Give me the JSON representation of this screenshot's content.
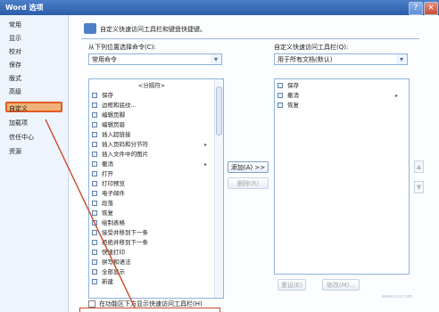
{
  "window": {
    "title": "Word 选项",
    "help_label": "?",
    "close_label": "×"
  },
  "nav": {
    "items": [
      {
        "label": "常用",
        "selected": false
      },
      {
        "label": "显示",
        "selected": false
      },
      {
        "label": "校对",
        "selected": false
      },
      {
        "label": "保存",
        "selected": false
      },
      {
        "label": "版式",
        "selected": false
      },
      {
        "label": "高级",
        "selected": false
      },
      {
        "label": "自定义",
        "selected": true
      },
      {
        "label": "加载项",
        "selected": false
      },
      {
        "label": "信任中心",
        "selected": false
      },
      {
        "label": "资源",
        "selected": false
      }
    ]
  },
  "main": {
    "heading": "自定义快速访问工具栏和键盘快捷键。",
    "left_label": "从下列位置选择命令(C):",
    "left_select_value": "常用命令",
    "right_label": "自定义快速访问工具栏(Q):",
    "right_select_value": "用于所有文档(默认)",
    "commands": [
      {
        "label": "<分隔符>",
        "icon": "separator-icon",
        "submenu": false
      },
      {
        "label": "保存",
        "icon": "save-icon",
        "submenu": false
      },
      {
        "label": "边框和底纹...",
        "icon": "border-icon",
        "submenu": false
      },
      {
        "label": "编辑页脚",
        "icon": "footer-icon",
        "submenu": false
      },
      {
        "label": "编辑页眉",
        "icon": "header-icon",
        "submenu": false
      },
      {
        "label": "插入超链接",
        "icon": "link-icon",
        "submenu": false
      },
      {
        "label": "插入页码和分节符",
        "icon": "page-number-icon",
        "submenu": true
      },
      {
        "label": "插入文件中的图片",
        "icon": "image-icon",
        "submenu": false
      },
      {
        "label": "撤消",
        "icon": "undo-icon",
        "submenu": true
      },
      {
        "label": "打开",
        "icon": "open-icon",
        "submenu": false
      },
      {
        "label": "打印预览",
        "icon": "print-preview-icon",
        "submenu": false
      },
      {
        "label": "电子邮件",
        "icon": "email-icon",
        "submenu": false
      },
      {
        "label": "段落",
        "icon": "paragraph-icon",
        "submenu": false
      },
      {
        "label": "恢复",
        "icon": "redo-icon",
        "submenu": false
      },
      {
        "label": "绘制表格",
        "icon": "draw-table-icon",
        "submenu": false
      },
      {
        "label": "接受并移到下一条",
        "icon": "accept-icon",
        "submenu": false
      },
      {
        "label": "拒绝并移到下一条",
        "icon": "reject-icon",
        "submenu": false
      },
      {
        "label": "快速打印",
        "icon": "quick-print-icon",
        "submenu": false
      },
      {
        "label": "拼写和语法",
        "icon": "spelling-icon",
        "submenu": false
      },
      {
        "label": "全部显示",
        "icon": "show-all-icon",
        "submenu": false
      },
      {
        "label": "新建",
        "icon": "new-icon",
        "submenu": false
      }
    ],
    "toolbar_items": [
      {
        "label": "保存",
        "icon": "save-icon",
        "submenu": false
      },
      {
        "label": "撤消",
        "icon": "undo-icon",
        "submenu": true
      },
      {
        "label": "恢复",
        "icon": "redo-icon",
        "submenu": false
      }
    ],
    "add_button": "添加(A) >>",
    "remove_button": "删除(R)",
    "reset_button": "重设(E)",
    "modify_button": "修改(M)...",
    "checkbox_label": "在功能区下方显示快速访问工具栏(H)",
    "up_arrow": "▲",
    "down_arrow": "▼",
    "watermark": "www.xxx.com"
  },
  "colors": {
    "titlebar": "#3467b7",
    "selection": "#f1b27a",
    "annotation": "#c74a27"
  }
}
